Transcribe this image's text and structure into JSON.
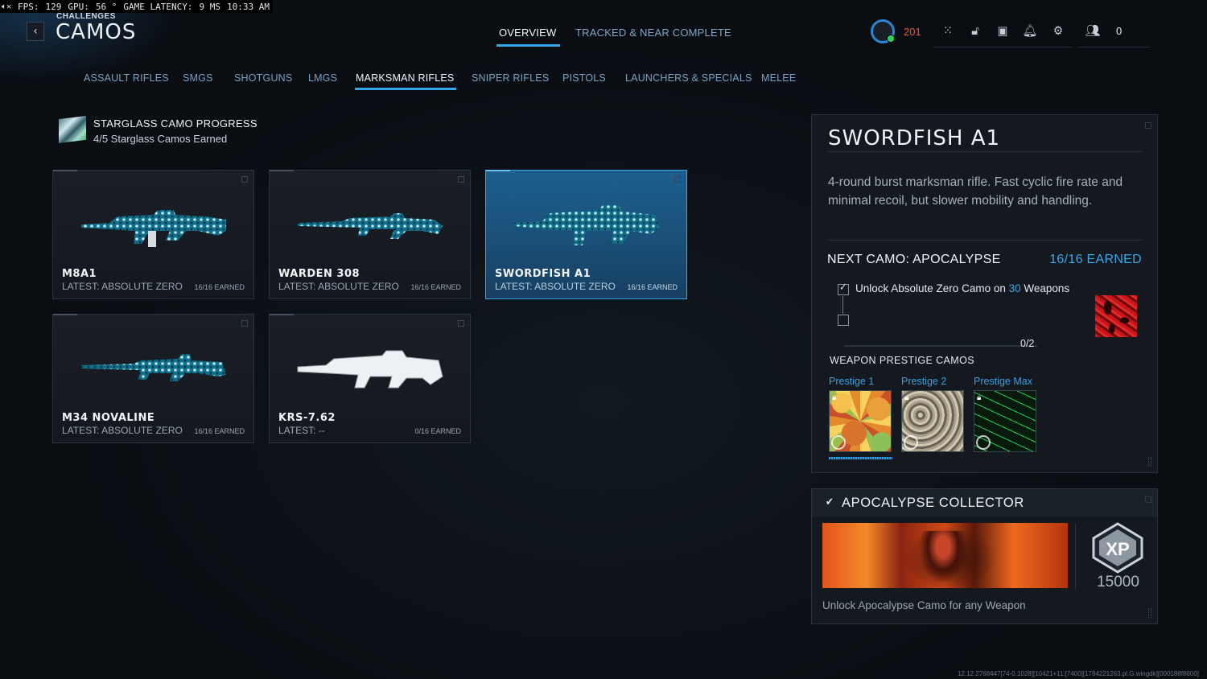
{
  "perf": {
    "fps_label": "FPS:",
    "fps": "129",
    "gpu_label": "GPU:",
    "gpu": "56 °",
    "latency_label": "GAME LATENCY:",
    "latency": "9 MS",
    "time": "10:33 AM"
  },
  "header": {
    "breadcrumb": "CHALLENGES",
    "title": "CAMOS",
    "tabs": [
      {
        "label": "OVERVIEW",
        "active": true
      },
      {
        "label": "TRACKED & NEAR COMPLETE",
        "active": false
      }
    ],
    "level": "201",
    "party_count": "0"
  },
  "categories": [
    "ASSAULT RIFLES",
    "SMGS",
    "SHOTGUNS",
    "LMGS",
    "MARKSMAN RIFLES",
    "SNIPER RIFLES",
    "PISTOLS",
    "LAUNCHERS & SPECIALS",
    "MELEE"
  ],
  "active_category": "MARKSMAN RIFLES",
  "starglass": {
    "title": "STARGLASS CAMO PROGRESS",
    "subtitle": "4/5 Starglass Camos Earned"
  },
  "weapons": [
    {
      "name": "M8A1",
      "latest": "LATEST: ABSOLUTE ZERO",
      "earned": "16/16 EARNED",
      "selected": false
    },
    {
      "name": "WARDEN 308",
      "latest": "LATEST: ABSOLUTE ZERO",
      "earned": "16/16 EARNED",
      "selected": false
    },
    {
      "name": "SWORDFISH A1",
      "latest": "LATEST: ABSOLUTE ZERO",
      "earned": "16/16 EARNED",
      "selected": true
    },
    {
      "name": "M34 NOVALINE",
      "latest": "LATEST: ABSOLUTE ZERO",
      "earned": "16/16 EARNED",
      "selected": false
    },
    {
      "name": "KRS-7.62",
      "latest": "LATEST: --",
      "earned": "0/16 EARNED",
      "selected": false
    }
  ],
  "detail": {
    "title": "SWORDFISH A1",
    "description": "4-round burst marksman rifle. Fast cyclic fire rate and minimal recoil, but slower mobility and handling.",
    "next_camo_label": "NEXT CAMO: APOCALYPSE",
    "earned": "16/16 EARNED",
    "requirement_prefix": "Unlock Absolute Zero Camo on ",
    "requirement_count": "30",
    "requirement_suffix": " Weapons",
    "progress_text": "0/2",
    "progress": 0,
    "prestige_title": "WEAPON PRESTIGE CAMOS",
    "prestige": [
      {
        "label": "Prestige 1"
      },
      {
        "label": "Prestige 2"
      },
      {
        "label": "Prestige Max"
      }
    ]
  },
  "collector": {
    "title": "APOCALYPSE COLLECTOR",
    "xp_label": "XP",
    "xp_amount": "15000",
    "description": "Unlock Apocalypse Camo for any Weapon"
  },
  "build_string": "12.12.2768447[74-0.1028][10421+11:[7400][1784221263.pl.G.wingdk][000188f8600]"
}
